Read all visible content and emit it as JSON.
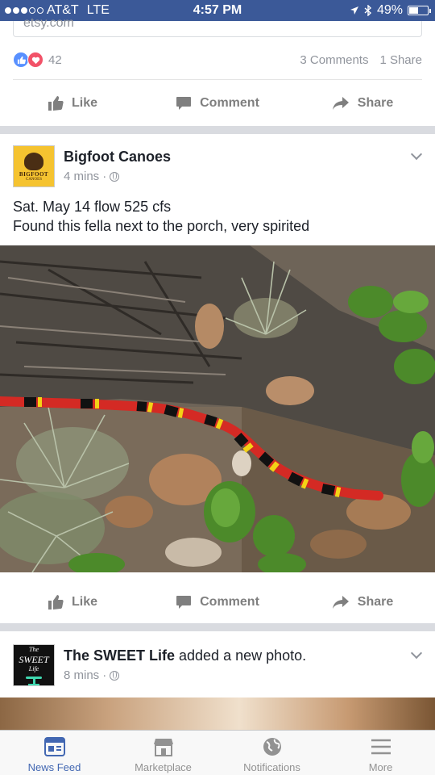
{
  "status_bar": {
    "carrier": "AT&T",
    "network": "LTE",
    "time": "4:57 PM",
    "battery": "49%",
    "battery_level": 0.49,
    "signal_bars": 3
  },
  "prev_post": {
    "link_domain": "etsy.com",
    "reaction_count": "42",
    "comments": "3 Comments",
    "shares": "1 Share"
  },
  "actions": {
    "like": "Like",
    "comment": "Comment",
    "share": "Share"
  },
  "post1": {
    "author": "Bigfoot Canoes",
    "avatar_text": "BIGFOOT",
    "avatar_subtext": "CANOES",
    "time": "4 mins",
    "line1": "Sat. May 14 flow 525 cfs",
    "line2": "Found this fella next to the porch, very spirited"
  },
  "post2": {
    "author": "The SWEET Life",
    "action": " added a new photo.",
    "avatar_line1": "The",
    "avatar_line2": "SWEET",
    "avatar_line3": "Life",
    "time": "8 mins"
  },
  "tabbar": {
    "tabs": [
      {
        "label": "News Feed",
        "icon": "news-feed-icon",
        "active": true
      },
      {
        "label": "Marketplace",
        "icon": "marketplace-icon",
        "active": false
      },
      {
        "label": "Notifications",
        "icon": "globe-icon",
        "active": false
      },
      {
        "label": "More",
        "icon": "menu-icon",
        "active": false
      }
    ]
  },
  "colors": {
    "brand": "#3b5998",
    "active_tab": "#4267b2",
    "like_reaction": "#5890ff",
    "love_reaction": "#f25268"
  }
}
